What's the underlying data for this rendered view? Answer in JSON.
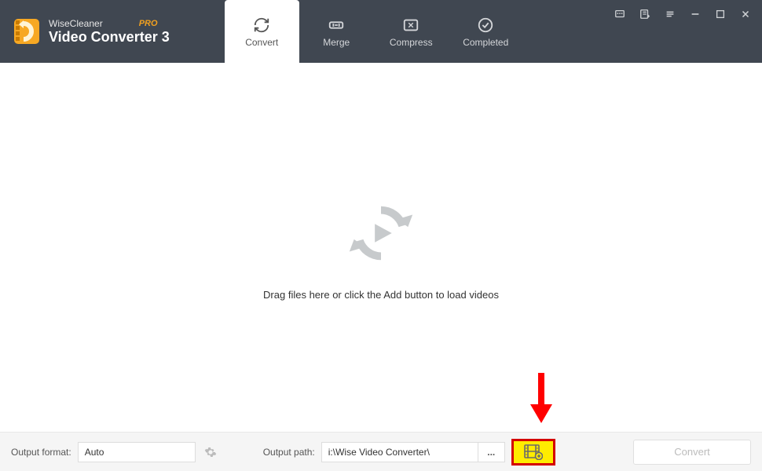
{
  "brand": {
    "company": "WiseCleaner",
    "product": "Video Converter 3",
    "edition": "PRO"
  },
  "tabs": [
    {
      "label": "Convert",
      "active": true
    },
    {
      "label": "Merge",
      "active": false
    },
    {
      "label": "Compress",
      "active": false
    },
    {
      "label": "Completed",
      "active": false
    }
  ],
  "dropzone": {
    "hint": "Drag files here or click the Add button to load videos"
  },
  "footer": {
    "format_label": "Output format:",
    "format_value": "Auto",
    "path_label": "Output path:",
    "path_value": "i:\\Wise Video Converter\\",
    "browse_label": "...",
    "convert_label": "Convert"
  }
}
